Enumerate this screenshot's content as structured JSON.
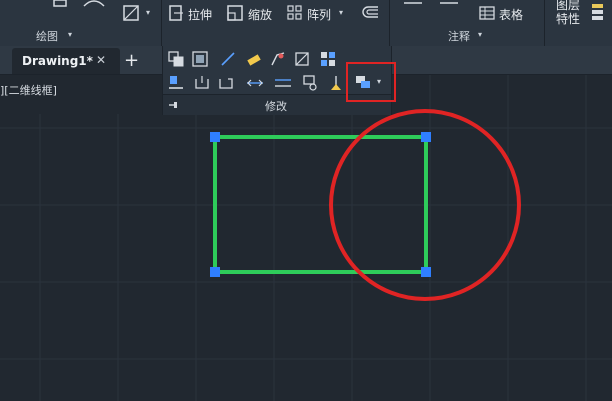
{
  "ribbon": {
    "draw_panel_label": "绘图",
    "annotate_panel_label": "注释",
    "stretch_label": "拉伸",
    "scale_label": "缩放",
    "array_label": "阵列",
    "table_label": "表格",
    "layer_props_line1": "图层",
    "layer_props_line2": "特性"
  },
  "tabs": {
    "document_title": "Drawing1*",
    "close_glyph": "✕",
    "new_tab_glyph": "+"
  },
  "viewport": {
    "label": "][二维线框]"
  },
  "modify_panel": {
    "label": "修改"
  },
  "colors": {
    "background": "#212830",
    "ribbon": "#2b3540",
    "rectangle_stroke": "#2ecc5a",
    "grip": "#2f7fff",
    "annotation_red": "#e02424"
  }
}
